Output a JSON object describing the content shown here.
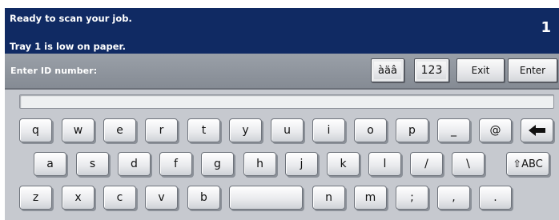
{
  "status": {
    "line1": "Ready to scan your job.",
    "line2": "Tray 1 is low on paper.",
    "job_count": "1"
  },
  "prompt": {
    "label": "Enter ID number:"
  },
  "controls": {
    "accent": "àäâ",
    "numeric": "123",
    "exit": "Exit",
    "enter": "Enter"
  },
  "input": {
    "value": ""
  },
  "keyboard": {
    "row1": [
      "q",
      "w",
      "e",
      "r",
      "t",
      "y",
      "u",
      "i",
      "o",
      "p",
      "_",
      "@"
    ],
    "backspace_icon": "left-arrow-icon",
    "row2": [
      "a",
      "s",
      "d",
      "f",
      "g",
      "h",
      "j",
      "k",
      "l",
      "/",
      "\\"
    ],
    "shift": "⇧ABC",
    "row3_left": [
      "z",
      "x",
      "c",
      "v",
      "b"
    ],
    "space": "",
    "row3_right": [
      "n",
      "m",
      ";",
      ",",
      "."
    ]
  },
  "colors": {
    "status_background": "#102a63",
    "panel_background": "#c6c9cf",
    "prompt_background": "#8e949c"
  }
}
